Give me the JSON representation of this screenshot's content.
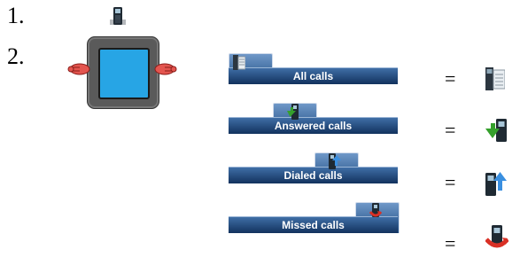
{
  "steps": [
    {
      "number": "1.",
      "icon": "phone-handset-icon"
    },
    {
      "number": "2.",
      "icon": "navigation-key-icon"
    }
  ],
  "tabs": [
    {
      "label": "All calls",
      "icon": "all-calls-icon",
      "result_icon": "all-calls-icon"
    },
    {
      "label": "Answered calls",
      "icon": "answered-calls-icon",
      "result_icon": "answered-calls-icon"
    },
    {
      "label": "Dialed calls",
      "icon": "dialed-calls-icon",
      "result_icon": "dialed-calls-icon"
    },
    {
      "label": "Missed calls",
      "icon": "missed-calls-icon",
      "result_icon": "missed-calls-icon"
    }
  ],
  "equals": "=",
  "colors": {
    "screen_blue": "#27a5e5",
    "tab_blue": "#1d4a80",
    "answered_green": "#35a02c",
    "dialed_blue": "#3a8fe0",
    "missed_red": "#d93025"
  }
}
